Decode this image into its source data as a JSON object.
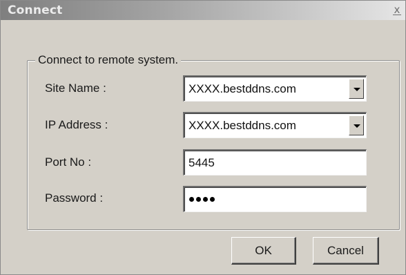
{
  "window": {
    "title": "Connect",
    "close_glyph": "x"
  },
  "group": {
    "legend": "Connect to remote system."
  },
  "fields": {
    "site_name": {
      "label": "Site Name :",
      "value": "XXXX.bestddns.com",
      "control": "dropdown"
    },
    "ip_address": {
      "label": "IP Address :",
      "value": "XXXX.bestddns.com",
      "control": "dropdown"
    },
    "port_no": {
      "label": "Port No :",
      "value": "5445",
      "control": "text"
    },
    "password": {
      "label": "Password :",
      "masked_char_count": 4,
      "control": "password"
    }
  },
  "buttons": {
    "ok_label": "OK",
    "cancel_label": "Cancel"
  },
  "icons": {
    "dropdown": "chevron-down-icon",
    "close": "close-icon"
  },
  "colors": {
    "dialog_background": "#d4d0c8",
    "title_gradient_start": "#7f7f7f",
    "title_gradient_end": "#e6e6e6",
    "field_background": "#ffffff"
  }
}
